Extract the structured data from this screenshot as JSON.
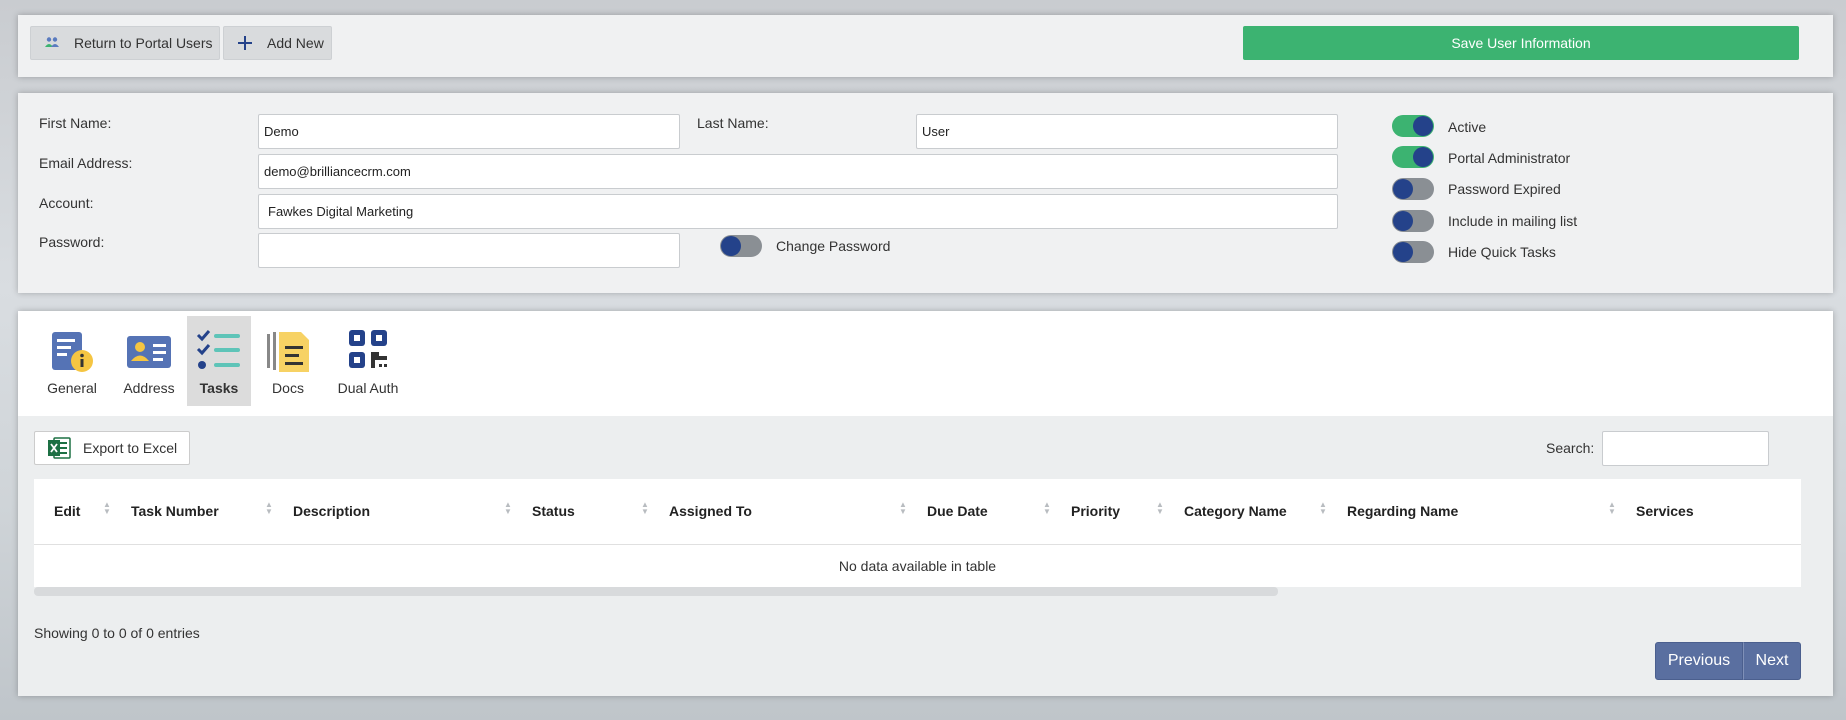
{
  "toolbar": {
    "return_label": "Return to Portal Users",
    "add_label": "Add New",
    "save_label": "Save User Information",
    "save_color": "#3cb371"
  },
  "form": {
    "first_name_label": "First Name:",
    "first_name_value": "Demo",
    "last_name_label": "Last Name:",
    "last_name_value": "User",
    "email_label": "Email Address:",
    "email_value": "demo@brilliancecrm.com",
    "account_label": "Account:",
    "account_value": "Fawkes Digital Marketing",
    "password_label": "Password:",
    "password_value": "",
    "change_password_label": "Change Password",
    "change_password_on": false
  },
  "toggles": [
    {
      "label": "Active",
      "on": true
    },
    {
      "label": "Portal Administrator",
      "on": true
    },
    {
      "label": "Password Expired",
      "on": false
    },
    {
      "label": "Include in mailing list",
      "on": false
    },
    {
      "label": "Hide Quick Tasks",
      "on": false
    }
  ],
  "tabs": [
    {
      "label": "General",
      "icon": "general-info-icon",
      "active": false
    },
    {
      "label": "Address",
      "icon": "address-card-icon",
      "active": false
    },
    {
      "label": "Tasks",
      "icon": "tasks-checklist-icon",
      "active": true
    },
    {
      "label": "Docs",
      "icon": "docs-icon",
      "active": false
    },
    {
      "label": "Dual Auth",
      "icon": "qr-code-icon",
      "active": false
    }
  ],
  "tasks": {
    "export_label": "Export to Excel",
    "search_label": "Search:",
    "search_value": "",
    "columns": [
      "Edit",
      "Task Number",
      "Description",
      "Status",
      "Assigned To",
      "Due Date",
      "Priority",
      "Category Name",
      "Regarding Name",
      "Services"
    ],
    "empty_message": "No data available in table",
    "info": "Showing 0 to 0 of 0 entries",
    "prev_label": "Previous",
    "next_label": "Next"
  },
  "colors": {
    "accent_green": "#3cb371",
    "toggle_knob": "#24428a",
    "pager": "#5a6fa0"
  }
}
